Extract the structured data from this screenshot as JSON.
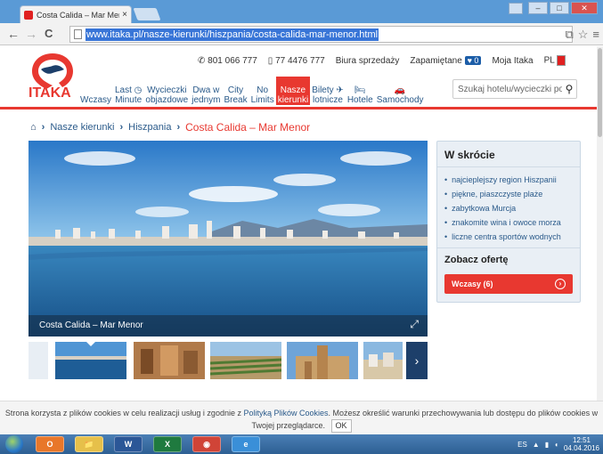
{
  "browser": {
    "tab_title": "Costa Calida – Mar Meno",
    "tab_close": "×",
    "url": "www.itaka.pl/nasze-kierunki/hiszpania/costa-calida-mar-menor.html",
    "back": "←",
    "forward": "→",
    "reload": "C",
    "menu": "≡",
    "star": "☆",
    "translate": "⧉",
    "win_minimize": "–",
    "win_maximize": "□",
    "win_close": "✕"
  },
  "header": {
    "logo_text": "ITAKA",
    "phone1_icon": "phone-icon",
    "phone1": "801 066 777",
    "phone2_icon": "mobile-icon",
    "phone2": "77 4476 777",
    "sales_offices": "Biura sprzedaży",
    "saved": "Zapamiętane",
    "saved_count": "0",
    "my_itaka": "Moja Itaka",
    "lang": "PL",
    "search_placeholder": "Szukaj hotelu/wycieczki po",
    "search_icon": "⚲"
  },
  "nav": [
    {
      "l1": "",
      "l2": "Wczasy"
    },
    {
      "l1": "Last ◷",
      "l2": "Minute"
    },
    {
      "l1": "Wycieczki",
      "l2": "objazdowe"
    },
    {
      "l1": "Dwa w",
      "l2": "jednym"
    },
    {
      "l1": "City",
      "l2": "Break"
    },
    {
      "l1": "No",
      "l2": "Limits"
    },
    {
      "l1": "Nasze",
      "l2": "kierunki"
    },
    {
      "l1": "Bilety ✈",
      "l2": "lotnicze"
    },
    {
      "l1": "🛏",
      "l2": "Hotele"
    },
    {
      "l1": "🚗",
      "l2": "Samochody"
    }
  ],
  "breadcrumb": {
    "home_icon": "⌂",
    "sep": "›",
    "level1": "Nasze kierunki",
    "level2": "Hiszpania",
    "current": "Costa Calida – Mar Menor"
  },
  "hero": {
    "caption": "Costa Calida – Mar Menor",
    "expand_icon": "⤢"
  },
  "thumbs": {
    "next": "›"
  },
  "summary": {
    "title": "W skrócie",
    "items": [
      "najcieplejszy region Hiszpanii",
      "piękne, piaszczyste plaże",
      "zabytkowa Murcja",
      "znakomite wina i owoce morza",
      "liczne centra sportów wodnych"
    ],
    "offer_title": "Zobacz ofertę",
    "offer_button": "Wczasy (6)",
    "offer_arrow": "›"
  },
  "cookie": {
    "text_before": "Strona korzysta z plików cookies w celu realizacji usług i zgodnie z ",
    "link": "Polityką Plików Cookies",
    "text_after": ". Możesz określić warunki przechowywania lub dostępu do plików cookies w Twojej przeglądarce.",
    "ok": "OK"
  },
  "taskbar": {
    "apps": [
      "O",
      "📁",
      "W",
      "X",
      "◉",
      "e"
    ],
    "lang": "ES",
    "time": "12:51",
    "date": "04.04.2016"
  },
  "colors": {
    "brand_red": "#e83830",
    "brand_navy": "#1d3f6a",
    "link_blue": "#2a5a8a",
    "sidebox_bg": "#e9eff5"
  }
}
